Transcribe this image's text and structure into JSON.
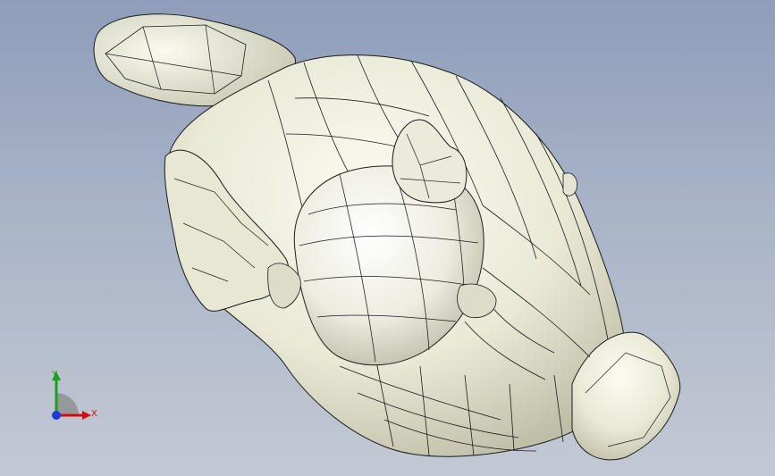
{
  "viewport": {
    "model_name": "",
    "background_top": "#8f9dba",
    "background_bottom": "#c3c9d4",
    "model_fill": "#ececdc",
    "edge_color": "#1a1a1a"
  },
  "triad": {
    "x_label": "X",
    "y_label": "Y",
    "x_color": "#d01010",
    "y_color": "#1aa21a",
    "z_color": "#1a3adb"
  }
}
